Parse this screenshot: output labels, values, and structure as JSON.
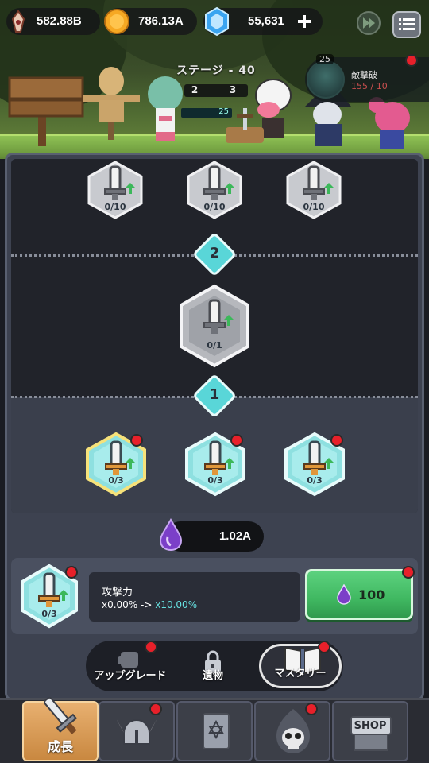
{
  "top_bar": {
    "crystal_amount": "582.88B",
    "gold_amount": "786.13A",
    "gem_amount": "55,631"
  },
  "stage": {
    "title": "ステージ - 40",
    "left_num": "2",
    "right_num": "3",
    "hp_value": "25"
  },
  "enemy": {
    "level": "25",
    "label": "敵撃破",
    "count": "155 / 10"
  },
  "tree": {
    "tier2_nodes": [
      {
        "count": "0/10"
      },
      {
        "count": "0/10"
      },
      {
        "count": "0/10"
      }
    ],
    "tier2_label": "2",
    "center_node": {
      "count": "0/1"
    },
    "tier1_label": "1",
    "tier1_nodes": [
      {
        "count": "0/3"
      },
      {
        "count": "0/3"
      },
      {
        "count": "0/3"
      }
    ]
  },
  "essence": {
    "amount": "1.02A"
  },
  "detail": {
    "node_count": "0/3",
    "title": "攻撃力",
    "value_from": "x0.00% ->",
    "value_to": " x10.00%",
    "buy_amount": "100"
  },
  "tabs": {
    "upgrade": "アップグレード",
    "relic": "遺物",
    "mastery": "マスタリー"
  },
  "bottom_nav": {
    "growth": "成長",
    "shop": "SHOP"
  }
}
